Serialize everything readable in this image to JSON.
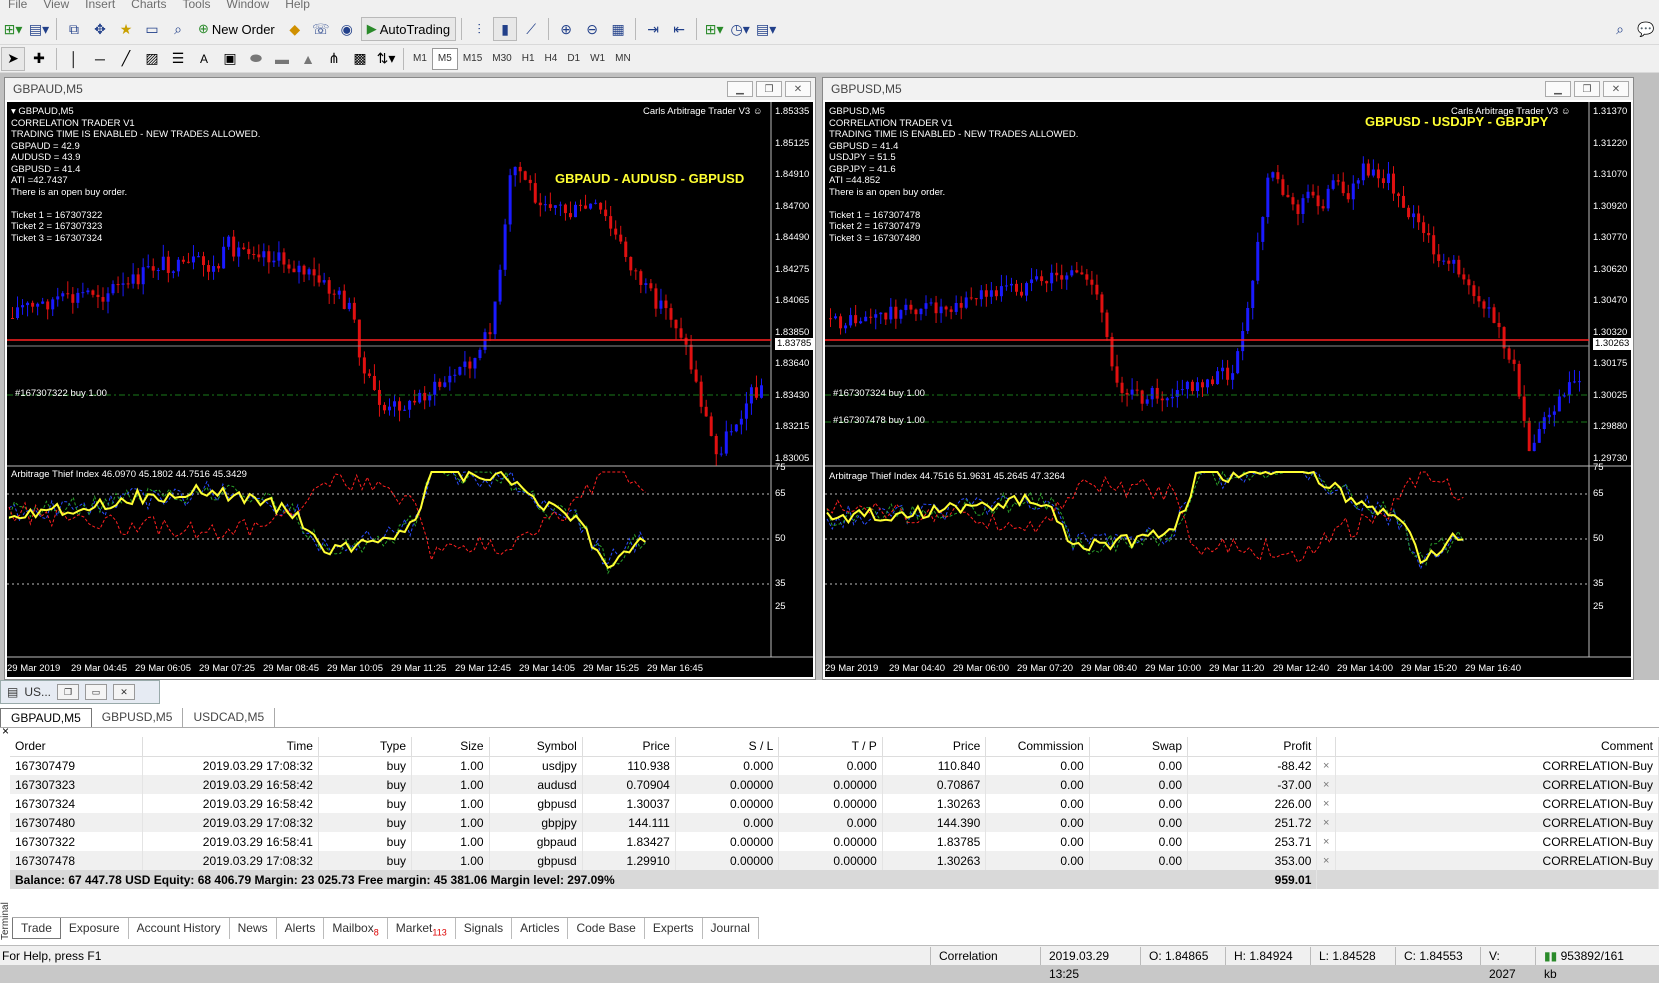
{
  "menu": [
    "File",
    "View",
    "Insert",
    "Charts",
    "Tools",
    "Window",
    "Help"
  ],
  "toolbar": {
    "new_order": "New Order",
    "autotrading": "AutoTrading"
  },
  "timeframes": [
    "M1",
    "M5",
    "M15",
    "M30",
    "H1",
    "H4",
    "D1",
    "W1",
    "MN"
  ],
  "active_timeframe": "M5",
  "charts": [
    {
      "window_title": "GBPAUD,M5",
      "symbol_line": "GBPAUD,M5",
      "info": "CORRELATION TRADER V1\nTRADING TIME IS ENABLED - NEW TRADES ALLOWED.\nGBPAUD = 42.9\nAUDUSD = 43.9\nGBPUSD = 41.4\nATI =42.7437\nThere is an open buy order.\n\nTicket 1 = 167307322\nTicket 2 = 167307323\nTicket 3 = 167307324",
      "ea_name": "Carls Arbitrage Trader V3",
      "pair_label": "GBPAUD - AUDUSD - GBPUSD",
      "order_lines": [
        "#167307322 buy 1.00"
      ],
      "indicator_label": "Arbitrage Thief Index 46.0970 45.1802 44.7516 45.3429",
      "price_ticks": [
        "1.85335",
        "1.85125",
        "1.84910",
        "1.84700",
        "1.84490",
        "1.84275",
        "1.84065",
        "1.83850",
        "1.83640",
        "1.83430",
        "1.83215",
        "1.83005"
      ],
      "current_price": "1.83785",
      "ind_ticks": [
        "75",
        "65",
        "50",
        "35",
        "25"
      ],
      "time_ticks": [
        "29 Mar 2019",
        "29 Mar 04:45",
        "29 Mar 06:05",
        "29 Mar 07:25",
        "29 Mar 08:45",
        "29 Mar 10:05",
        "29 Mar 11:25",
        "29 Mar 12:45",
        "29 Mar 14:05",
        "29 Mar 15:25",
        "29 Mar 16:45"
      ]
    },
    {
      "window_title": "GBPUSD,M5",
      "symbol_line": "GBPUSD,M5",
      "info": "CORRELATION TRADER V1\nTRADING TIME IS ENABLED - NEW TRADES ALLOWED.\nGBPUSD = 41.4\nUSDJPY = 51.5\nGBPJPY = 41.6\nATI =44.852\nThere is an open buy order.\n\nTicket 1 = 167307478\nTicket 2 = 167307479\nTicket 3 = 167307480",
      "ea_name": "Carls Arbitrage Trader V3",
      "pair_label": "GBPUSD - USDJPY - GBPJPY",
      "order_lines": [
        "#167307324 buy 1.00",
        "#167307478 buy 1.00"
      ],
      "indicator_label": "Arbitrage Thief Index 44.7516 51.9631 45.2645 47.3264",
      "price_ticks": [
        "1.31370",
        "1.31220",
        "1.31070",
        "1.30920",
        "1.30770",
        "1.30620",
        "1.30470",
        "1.30320",
        "1.30175",
        "1.30025",
        "1.29880",
        "1.29730"
      ],
      "current_price": "1.30263",
      "ind_ticks": [
        "75",
        "65",
        "50",
        "35",
        "25"
      ],
      "time_ticks": [
        "29 Mar 2019",
        "29 Mar 04:40",
        "29 Mar 06:00",
        "29 Mar 07:20",
        "29 Mar 08:40",
        "29 Mar 10:00",
        "29 Mar 11:20",
        "29 Mar 12:40",
        "29 Mar 14:00",
        "29 Mar 15:20",
        "29 Mar 16:40"
      ]
    }
  ],
  "terminal": {
    "title": "US...",
    "window_tabs": [
      "GBPAUD,M5",
      "GBPUSD,M5",
      "USDCAD,M5"
    ],
    "columns": [
      "Order",
      "Time",
      "Type",
      "Size",
      "Symbol",
      "Price",
      "S / L",
      "T / P",
      "Price",
      "Commission",
      "Swap",
      "Profit",
      "",
      "Comment"
    ],
    "rows": [
      [
        "167307479",
        "2019.03.29 17:08:32",
        "buy",
        "1.00",
        "usdjpy",
        "110.938",
        "0.000",
        "0.000",
        "110.840",
        "0.00",
        "0.00",
        "-88.42",
        "×",
        "CORRELATION-Buy"
      ],
      [
        "167307323",
        "2019.03.29 16:58:42",
        "buy",
        "1.00",
        "audusd",
        "0.70904",
        "0.00000",
        "0.00000",
        "0.70867",
        "0.00",
        "0.00",
        "-37.00",
        "×",
        "CORRELATION-Buy"
      ],
      [
        "167307324",
        "2019.03.29 16:58:42",
        "buy",
        "1.00",
        "gbpusd",
        "1.30037",
        "0.00000",
        "0.00000",
        "1.30263",
        "0.00",
        "0.00",
        "226.00",
        "×",
        "CORRELATION-Buy"
      ],
      [
        "167307480",
        "2019.03.29 17:08:32",
        "buy",
        "1.00",
        "gbpjpy",
        "144.111",
        "0.000",
        "0.000",
        "144.390",
        "0.00",
        "0.00",
        "251.72",
        "×",
        "CORRELATION-Buy"
      ],
      [
        "167307322",
        "2019.03.29 16:58:41",
        "buy",
        "1.00",
        "gbpaud",
        "1.83427",
        "0.00000",
        "0.00000",
        "1.83785",
        "0.00",
        "0.00",
        "253.71",
        "×",
        "CORRELATION-Buy"
      ],
      [
        "167307478",
        "2019.03.29 17:08:32",
        "buy",
        "1.00",
        "gbpusd",
        "1.29910",
        "0.00000",
        "0.00000",
        "1.30263",
        "0.00",
        "0.00",
        "353.00",
        "×",
        "CORRELATION-Buy"
      ]
    ],
    "balance_line": "Balance: 67 447.78 USD  Equity: 68 406.79  Margin: 23 025.73  Free margin: 45 381.06  Margin level: 297.09%",
    "total_profit": "959.01",
    "bottom_tabs": [
      {
        "label": "Trade",
        "badge": ""
      },
      {
        "label": "Exposure",
        "badge": ""
      },
      {
        "label": "Account History",
        "badge": ""
      },
      {
        "label": "News",
        "badge": ""
      },
      {
        "label": "Alerts",
        "badge": ""
      },
      {
        "label": "Mailbox",
        "badge": "8"
      },
      {
        "label": "Market",
        "badge": "113"
      },
      {
        "label": "Signals",
        "badge": ""
      },
      {
        "label": "Articles",
        "badge": ""
      },
      {
        "label": "Code Base",
        "badge": ""
      },
      {
        "label": "Experts",
        "badge": ""
      },
      {
        "label": "Journal",
        "badge": ""
      }
    ],
    "side_label": "Terminal"
  },
  "status": {
    "help": "For Help, press F1",
    "profile": "Correlation",
    "datetime": "2019.03.29 13:25",
    "open": "O: 1.84865",
    "high": "H: 1.84924",
    "low": "L: 1.84528",
    "close": "C: 1.84553",
    "volume": "V: 2027",
    "traffic": "953892/161 kb"
  },
  "colors": {
    "bull": "#1a1aff",
    "bear": "#e01010",
    "ati": "#ffff33",
    "price_line": "#ff2020",
    "order_line": "#1a7a1a"
  }
}
